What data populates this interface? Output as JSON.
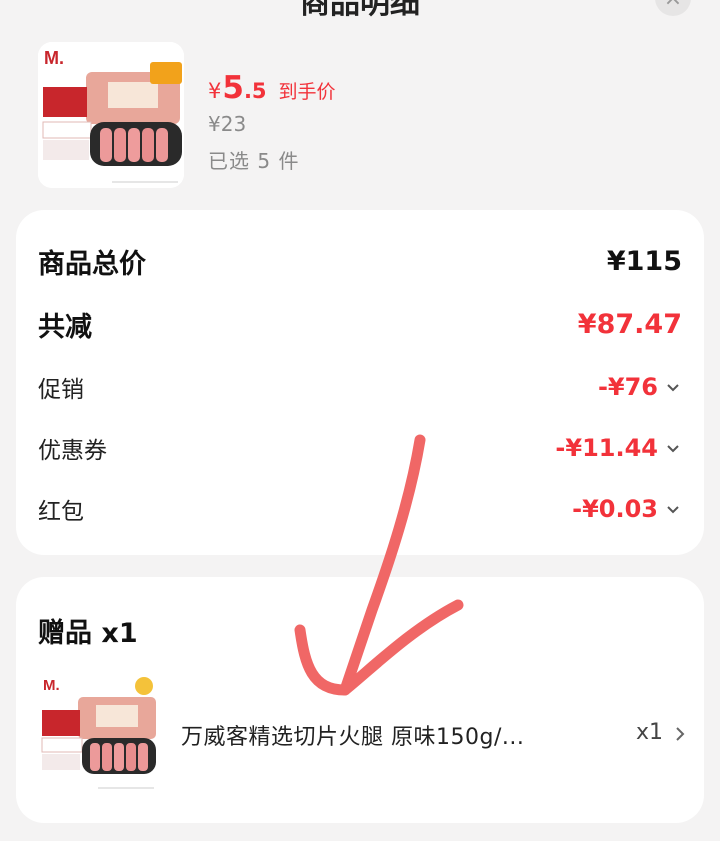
{
  "header": {
    "title": "商品明细",
    "close_icon": "close-icon"
  },
  "product": {
    "image_icon": "ham-product-image",
    "price_currency": "¥",
    "price_integer": "5",
    "price_decimal": ".5",
    "price_tag": "到手价",
    "original_price": "¥23",
    "selected_count": "已选 5 件"
  },
  "price_breakdown": {
    "total_label": "商品总价",
    "total_value": "¥115",
    "discount_label": "共减",
    "discount_value": "¥87.47",
    "items": [
      {
        "label": "促销",
        "value": "-¥76"
      },
      {
        "label": "优惠券",
        "value": "-¥11.44"
      },
      {
        "label": "红包",
        "value": "-¥0.03"
      }
    ]
  },
  "gift": {
    "title": "赠品 x1",
    "name": "万威客精选切片火腿 原味150g/...",
    "qty": "x1"
  },
  "colors": {
    "accent_red": "#f2323a",
    "annotation_red": "#f06766",
    "card_bg": "#ffffff",
    "page_bg": "#f4f3f3"
  }
}
